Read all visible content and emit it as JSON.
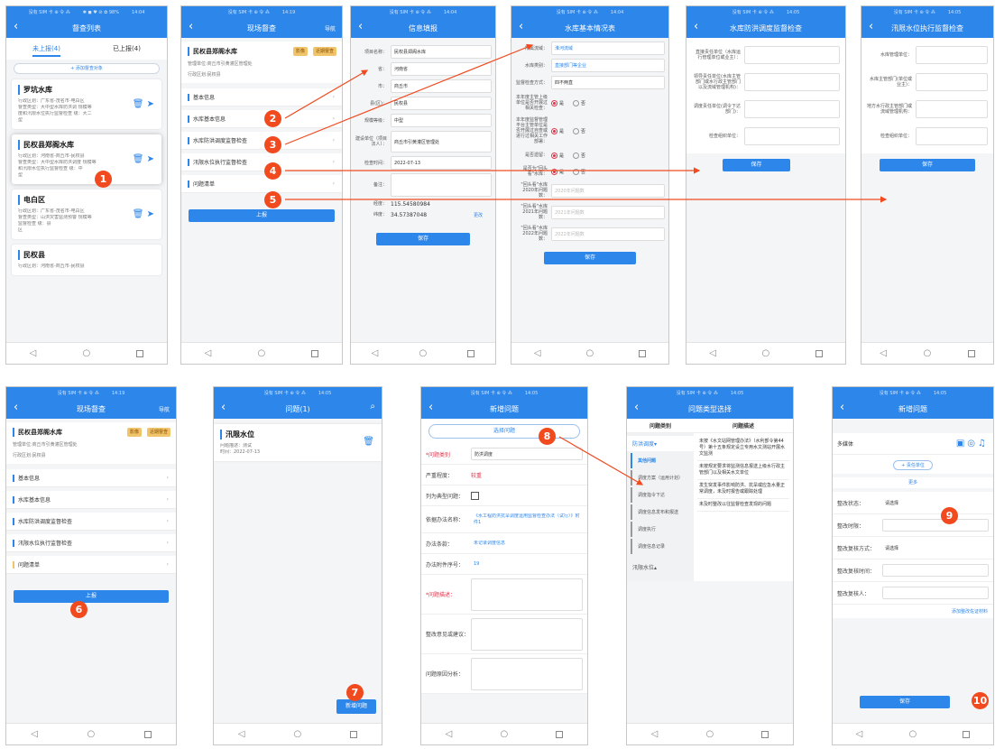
{
  "status": {
    "left": "没有 SIM 卡 ⊕ 令 ⁂",
    "right": "✱ ◼ ♥ ⊘ ✿ 98%"
  },
  "times": {
    "p1": "14:04",
    "p2": "14:19",
    "p3": "14:04",
    "p4": "14:04",
    "p5": "14:05",
    "p6": "14:05",
    "p7": "14:19",
    "p8": "14:05",
    "p9": "14:05",
    "p10": "14:05",
    "p11": "14:05"
  },
  "p1": {
    "title": "督查列表",
    "tab_pending": "未上报(4)",
    "tab_done": "已上报(4)",
    "add": "+ 添加督查对象",
    "cards": [
      {
        "name": "罗坑水库",
        "l1": "行政区划：广东省-茂名市-电白区",
        "l2": "督查类型：大中型水库防洪调  规模等",
        "l3": "度和汛限水位执行监督检查      级：大二",
        "l4": "型"
      },
      {
        "name": "民权县郑阁水库",
        "l1": "行政区划：河南省-商丘市-民权县",
        "l2": "督查类型：大中型水库防洪调度 规模等",
        "l3": "和汛限水位执行监督检查      级：中",
        "l4": "型"
      },
      {
        "name": "电白区",
        "l1": "行政区划：广东省-茂名市-电白区",
        "l2": "督查类型：山洪灾害监测预警  规模等",
        "l3": "监督检查                   级：县",
        "l4": "区"
      },
      {
        "name": "民权县",
        "l1": "行政区划：河南省-商丘市-民权县",
        "l2": "",
        "l3": "",
        "l4": ""
      }
    ]
  },
  "site": {
    "title": "现场督查",
    "nav": "导航",
    "name": "民权县郑阁水库",
    "img_btn": "影像",
    "near_btn": "近期督查",
    "mgr": "管理单位:商丘市引黄灌区管理处",
    "district": "行政区划:民权县",
    "menu": [
      "基本信息",
      "水库基本信息",
      "水库防洪调度监督检查",
      "汛限水位执行监督检查",
      "问题清单"
    ],
    "report": "上报"
  },
  "p3": {
    "title": "信息填报",
    "rows": [
      {
        "lb": "项目名称：",
        "v": "民权县郑阁水库"
      },
      {
        "lb": "省：",
        "v": "河南省"
      },
      {
        "lb": "市：",
        "v": "商丘市"
      },
      {
        "lb": "县(区)：",
        "v": "民权县"
      },
      {
        "lb": "规模等级：",
        "v": "中型"
      },
      {
        "lb": "建设单位（项目法人）：",
        "v": "商丘市引黄灌区管理处"
      },
      {
        "lb": "检查时间：",
        "v": "2022-07-13"
      },
      {
        "lb": "备注：",
        "v": ""
      }
    ],
    "lon_lb": "经度：",
    "lon": "115.54580984",
    "lat_lb": "纬度：",
    "lat": "34.57387048",
    "modify": "更改",
    "save": "保存"
  },
  "p4": {
    "title": "水库基本情况表",
    "rows": [
      {
        "lb": "所属流域：",
        "v": "淮河流域"
      },
      {
        "lb": "水库类别：",
        "v": "直接部门等企业"
      },
      {
        "lb": "监督检查方式：",
        "v": "四不两直"
      }
    ],
    "q1": "本年度主管上级单位是否开展过相关检查：",
    "q2": "本年度监督管理平台主管单位是否开展过自查或进行过相关工作部署：",
    "q3": "是否遗留：",
    "q4": "是否为\"回头看\"水库：",
    "yes": "是",
    "no": "否",
    "p1lb": "\"回头看\"水库2020年问题数：",
    "p1": "2020年问题数",
    "p2lb": "\"回头看\"水库2021年问题数：",
    "p2": "2021年问题数",
    "p3lb": "\"回头看\"水库2022年问题数：",
    "p3": "2022年问题数",
    "save": "保存"
  },
  "p5": {
    "title": "水库防洪调度监督检查",
    "rows": [
      "直接责任单位（水库运行管理单位或业主）：",
      "领导责任单位(水库主管部门或水行政主管部门以及流域管理机构)：",
      "调度责任单位(调令下达部门)：",
      "检查组织单位："
    ],
    "save": "保存"
  },
  "p6": {
    "title": "汛限水位执行监督检查",
    "rows": [
      "水库管理单位：",
      "水库主管部门(单位或业主)：",
      "地方水行政主管部门或流域管理机构：",
      "检查组织单位："
    ],
    "save": "保存"
  },
  "p8": {
    "title": "问题(1)",
    "item_title": "汛限水位",
    "desc": "问题描述：测试",
    "time": "时间：2022-07-13",
    "add": "新增问题"
  },
  "p9": {
    "title": "新增问题",
    "select": "选择问题",
    "rows": [
      {
        "lb": "*问题类别",
        "v": "防洪调度",
        "t": "box"
      },
      {
        "lb": "严重程度：",
        "v": "较重",
        "t": "red"
      },
      {
        "lb": "列为典型问题：",
        "v": "",
        "t": "check"
      },
      {
        "lb": "依据办法名称：",
        "v": "《水工程防洪抗旱调度运用监督检查办法（试行）》附件1",
        "t": "blue"
      },
      {
        "lb": "办法条款：",
        "v": "未记录调度信息",
        "t": "blue"
      },
      {
        "lb": "办法附件序号：",
        "v": "19",
        "t": "blue"
      },
      {
        "lb": "*问题描述：",
        "v": "",
        "t": "area"
      },
      {
        "lb": "整改意见或建议：",
        "v": "",
        "t": "area"
      },
      {
        "lb": "问题原因分析：",
        "v": "",
        "t": "area"
      }
    ]
  },
  "p10": {
    "title": "问题类型选择",
    "col1": "问题类别",
    "col2": "问题描述",
    "cat": "防洪调度",
    "subs": [
      "其他问题",
      "调度方案（运用计划）",
      "调度指令下达",
      "调度信息发布和报送",
      "调度执行",
      "调度信息记录"
    ],
    "cat2": "汛限水位",
    "descs": [
      "未按《水文站网管理办法》（水利部令第44号）第十五条规定设立专用水文测站开展水文监测",
      "未按规定要求将监测信息报送上级水行政主管部门以及相关水文单位",
      "发生突发事件影响防洪、抗旱或应急水量正常调度，未及时报告或跟踪处理",
      "未及时整改以往监督检查发现的问题"
    ]
  },
  "p11": {
    "title": "新增问题",
    "media": "多媒体",
    "resp": "+ 责任单位",
    "more": "更多",
    "rows": [
      {
        "lb": "整改状态：",
        "v": "请选择"
      },
      {
        "lb": "整改时限：",
        "v": ""
      },
      {
        "lb": "整改复核方式：",
        "v": "请选择"
      },
      {
        "lb": "整改复核时间：",
        "v": ""
      },
      {
        "lb": "整改复核人：",
        "v": ""
      }
    ],
    "add_proof": "添加整改佐证材料",
    "save": "保存"
  },
  "badges": [
    "1",
    "2",
    "3",
    "4",
    "5",
    "6",
    "7",
    "8",
    "9",
    "10"
  ]
}
